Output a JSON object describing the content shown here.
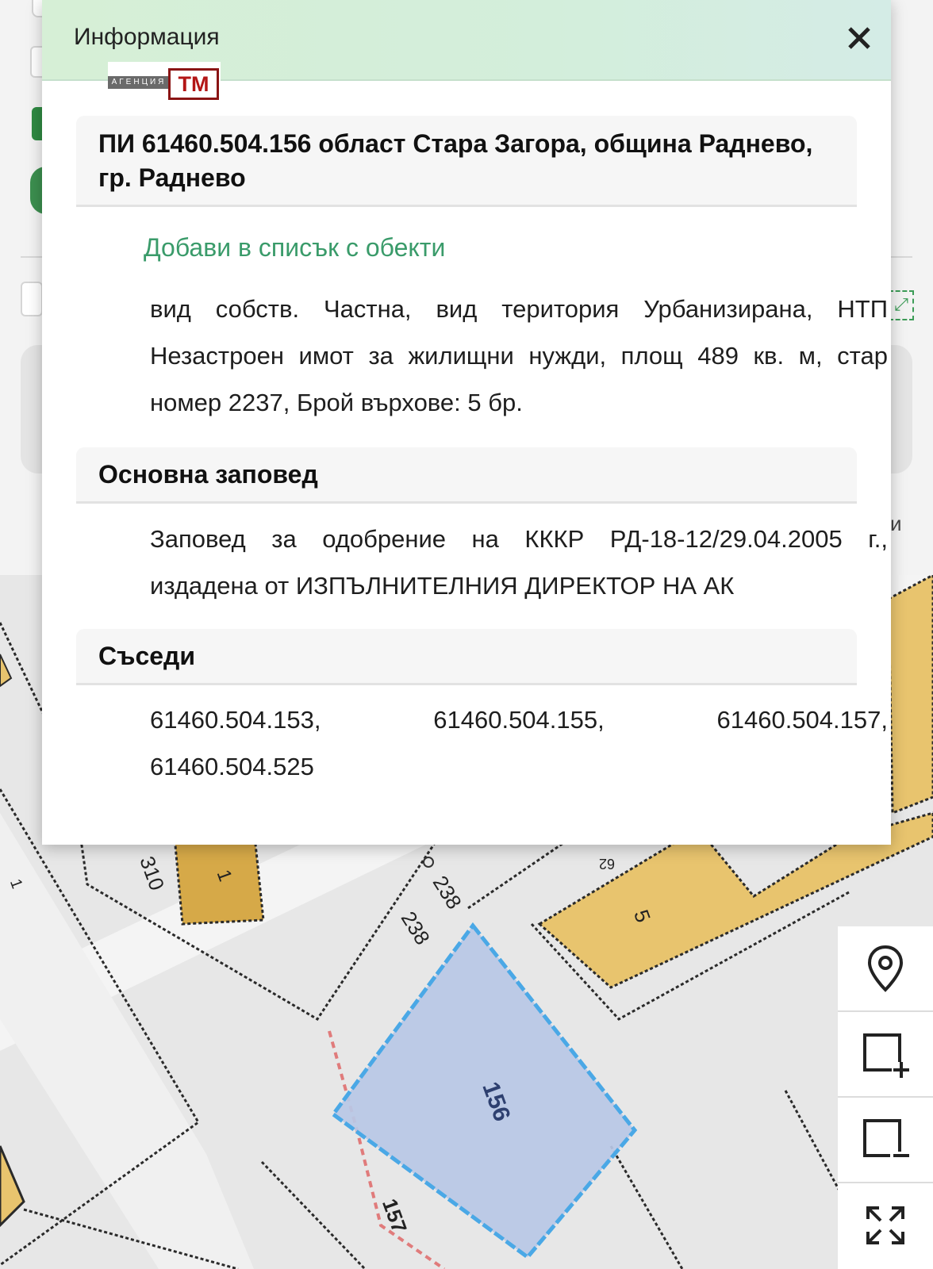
{
  "modal": {
    "title": "Информация",
    "logo": {
      "small_text": "АГЕНЦИЯ",
      "big_text": "ТМ"
    },
    "parcel_title": "ПИ 61460.504.156 област Стара Загора, община Раднево, гр. Раднево",
    "add_to_list_label": "Добави в списък с обекти",
    "description": "вид собств. Частна, вид територия Урбанизирана, НТП Незастроен имот за жилищни нужди, площ 489 кв. м, стар номер 2237, Брой върхове: 5 бр.",
    "order_heading": "Основна заповед",
    "order_text": "Заповед за одобрение на КККР РД-18-12/29.04.2005 г., издадена от ИЗПЪЛНИТЕЛНИЯ ДИРЕКТОР НА АК",
    "neighbors_heading": "Съседи",
    "neighbors": [
      "61460.504.153,",
      "61460.504.155,",
      "61460.504.157,",
      "61460.504.525"
    ]
  },
  "background": {
    "partial_label": "и"
  },
  "map": {
    "labels": {
      "parcel_selected": "156",
      "street_1": "238",
      "street_2": "238",
      "building_310": "310",
      "building_1": "1",
      "building_5": "5",
      "building_62": "62",
      "parcel_157": "157",
      "left_edge": "1"
    },
    "colors": {
      "selected_fill": "#b9c8e6",
      "selected_border": "#4aa8e6",
      "building": "#e6c26d",
      "building_dark": "#cfa23f",
      "accent": "#3c8f4f"
    }
  },
  "toolbar": {
    "buttons": [
      {
        "name": "location-pin-icon"
      },
      {
        "name": "add-rectangle-icon"
      },
      {
        "name": "remove-rectangle-icon"
      },
      {
        "name": "fullscreen-icon"
      }
    ]
  }
}
